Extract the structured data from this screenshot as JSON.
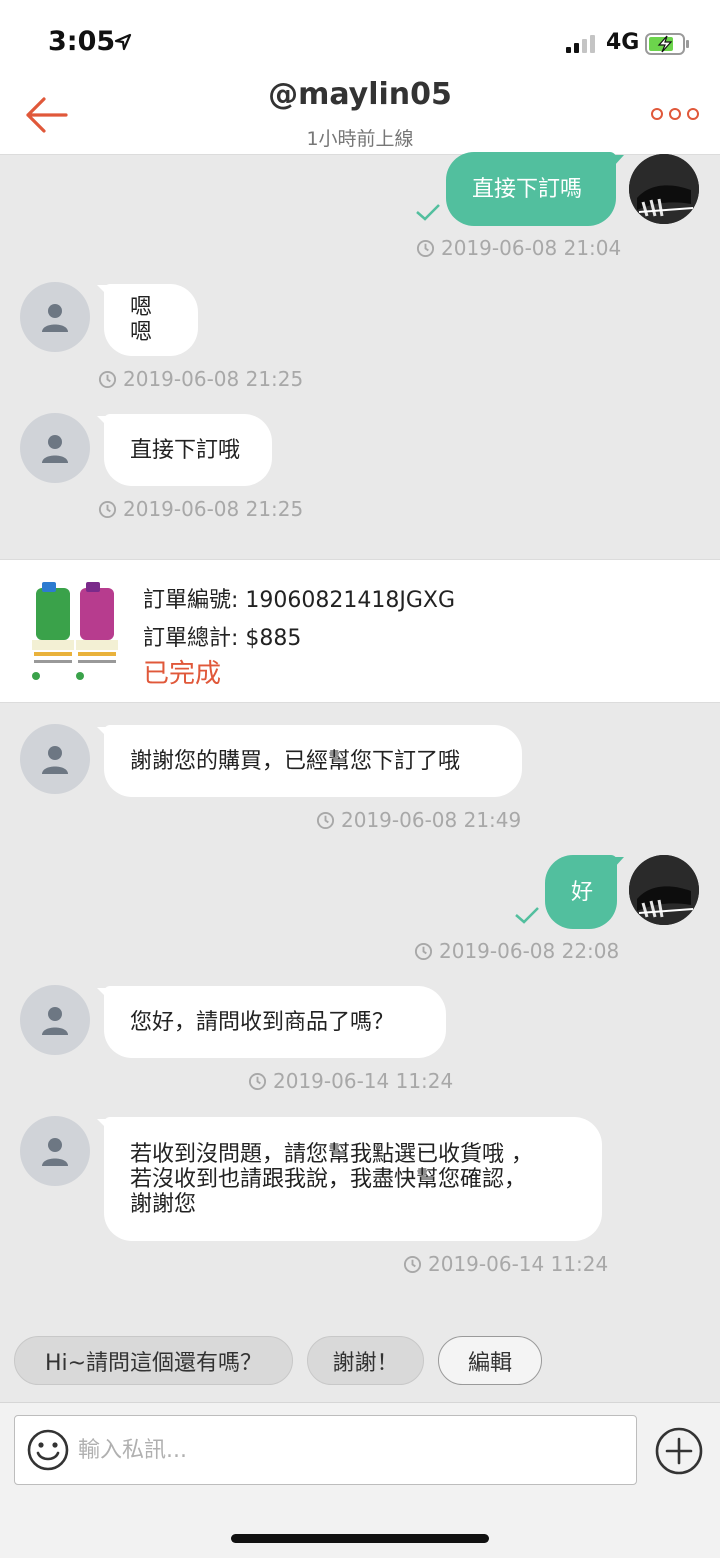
{
  "status_bar": {
    "time": "3:05",
    "network": "4G"
  },
  "header": {
    "title": "@maylin05",
    "subtitle": "1小時前上線",
    "back_icon": "back-arrow-icon",
    "more_icon": "more-dots-icon"
  },
  "colors": {
    "accent": "#e0583a",
    "outgoing_bubble": "#52bf9e",
    "background": "#e9e9e9"
  },
  "messages": [
    {
      "dir": "out",
      "text": "直接下訂嗎",
      "time": "2019-06-08 21:04",
      "read": true
    },
    {
      "dir": "in",
      "text": "嗯嗯",
      "time": "2019-06-08 21:25"
    },
    {
      "dir": "in",
      "text": "直接下訂哦",
      "time": "2019-06-08 21:25"
    },
    {
      "dir": "in",
      "text": "謝謝您的購買，已經幫您下訂了哦",
      "time": "2019-06-08 21:49"
    },
    {
      "dir": "out",
      "text": "好",
      "time": "2019-06-08 22:08",
      "read": true
    },
    {
      "dir": "in",
      "text": "您好，請問收到商品了嗎？",
      "time": "2019-06-14 11:24"
    },
    {
      "dir": "in",
      "lines": [
        "若收到沒問題，請您幫我點選已收貨哦 ，",
        "若沒收到也請跟我說，我盡快幫您確認，",
        "謝謝您"
      ],
      "time": "2019-06-14 11:24"
    }
  ],
  "order": {
    "number_label": "訂單編號: 19060821418JGXG",
    "total_label": "訂單總計: $885",
    "status": "已完成"
  },
  "quick_replies": [
    "Hi~請問這個還有嗎？",
    "謝謝！",
    "編輯"
  ],
  "composer": {
    "placeholder": "輸入私訊...",
    "emoji_icon": "smiley-icon",
    "add_icon": "plus-circle-icon"
  }
}
